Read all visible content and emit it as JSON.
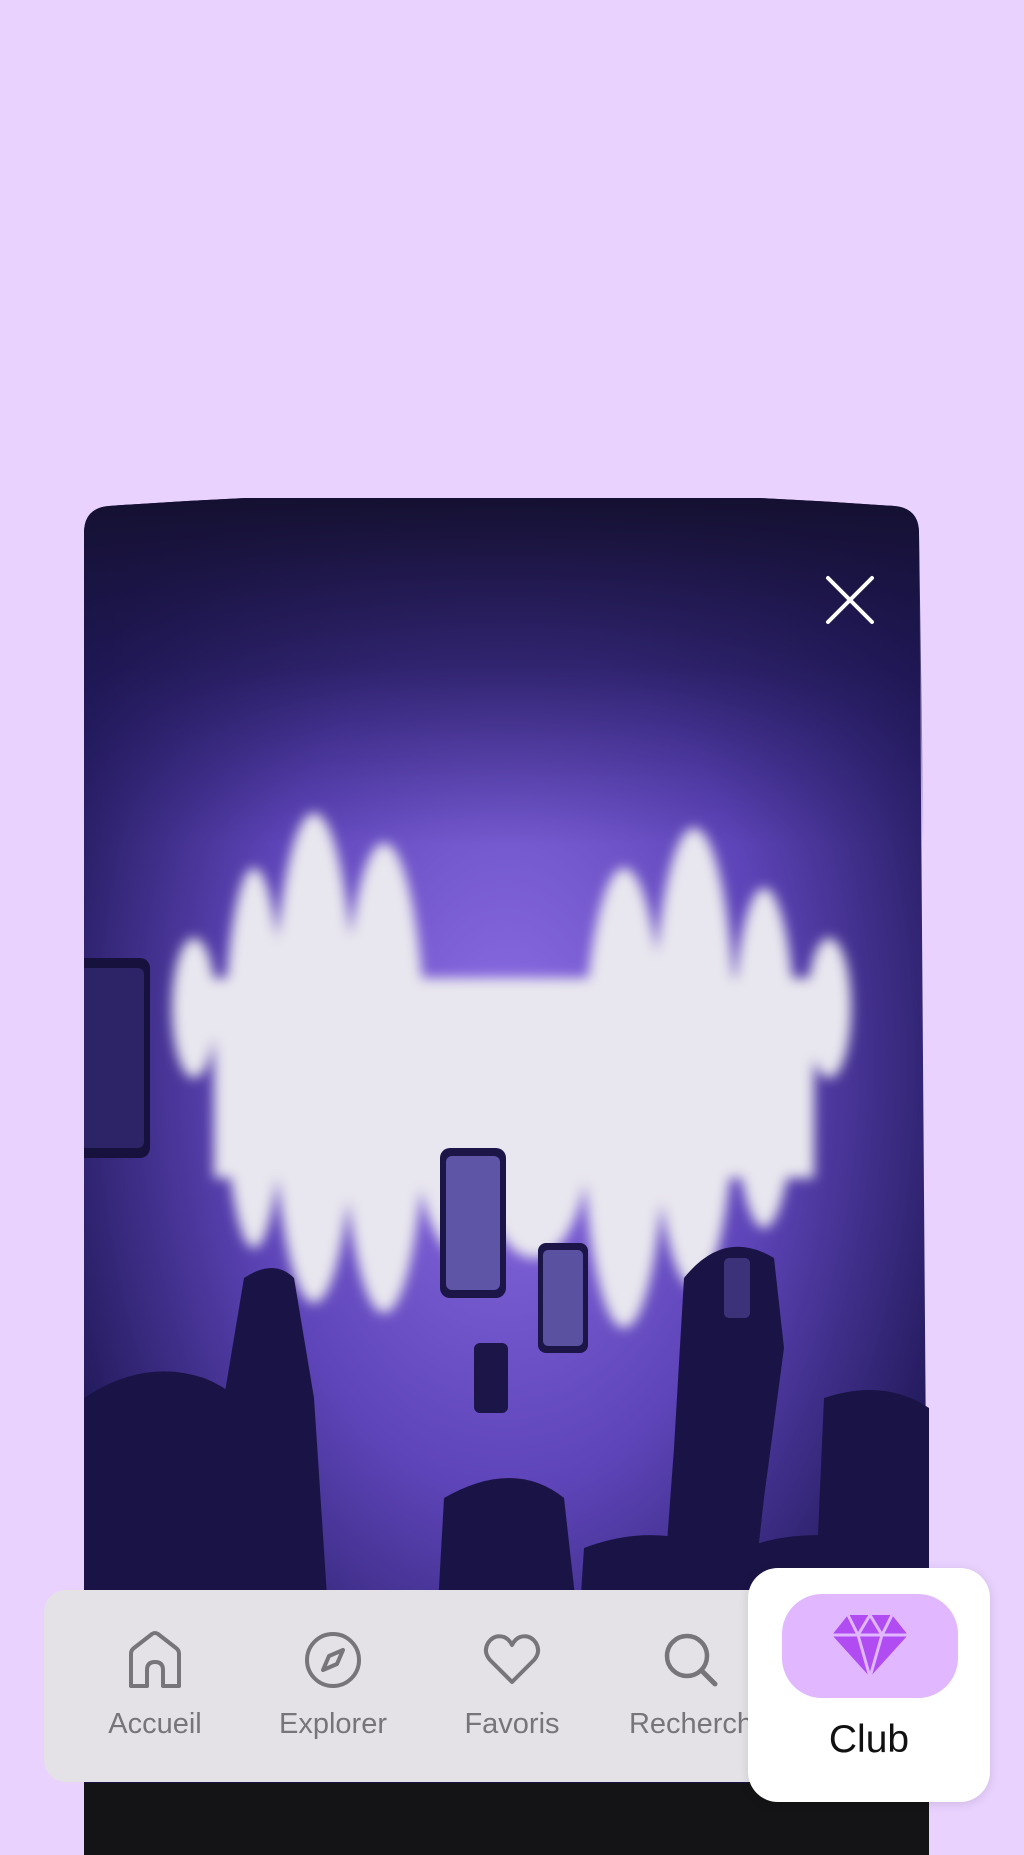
{
  "nav": {
    "items": [
      {
        "label": "Accueil",
        "icon": "home-icon"
      },
      {
        "label": "Explorer",
        "icon": "compass-icon"
      },
      {
        "label": "Favoris",
        "icon": "heart-icon"
      },
      {
        "label": "Recherch",
        "icon": "search-icon"
      }
    ],
    "active": {
      "label": "Club",
      "icon": "diamond-icon"
    }
  },
  "colors": {
    "page_background": "#ead2ff",
    "club_accent": "#b04cf2",
    "club_pill": "#e1b7ff",
    "nav_background": "#e4e2e6",
    "nav_text": "#77747a"
  },
  "promo": {
    "image": "concert-crowd-photo",
    "close_icon": "close-icon"
  }
}
